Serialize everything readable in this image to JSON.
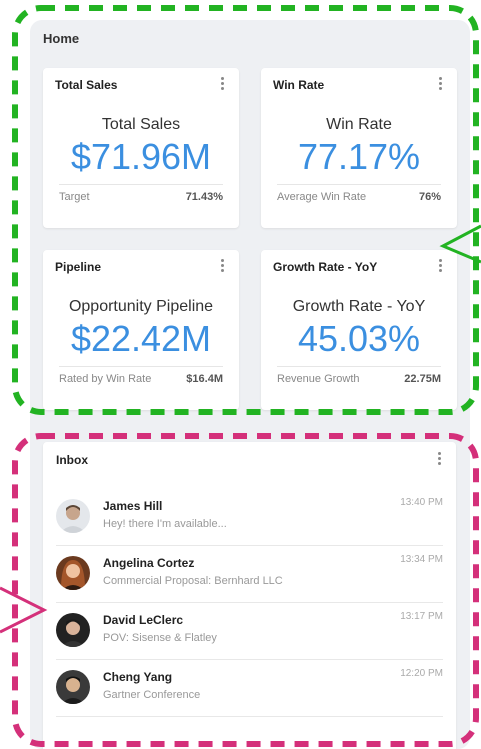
{
  "page": {
    "title": "Home"
  },
  "cards": [
    {
      "title": "Total Sales",
      "label": "Total Sales",
      "value": "$71.96M",
      "foot_label": "Target",
      "foot_value": "71.43%"
    },
    {
      "title": "Win Rate",
      "label": "Win Rate",
      "value": "77.17%",
      "foot_label": "Average Win Rate",
      "foot_value": "76%"
    },
    {
      "title": "Pipeline",
      "label": "Opportunity Pipeline",
      "value": "$22.42M",
      "foot_label": "Rated by Win Rate",
      "foot_value": "$16.4M"
    },
    {
      "title": "Growth Rate - YoY",
      "label": "Growth Rate - YoY",
      "value": "45.03%",
      "foot_label": "Revenue Growth",
      "foot_value": "22.75M"
    }
  ],
  "inbox": {
    "title": "Inbox",
    "messages": [
      {
        "sender": "James Hill",
        "preview": "Hey! there I'm available...",
        "time": "13:40 PM"
      },
      {
        "sender": "Angelina Cortez",
        "preview": "Commercial Proposal: Bernhard LLC",
        "time": "13:34 PM"
      },
      {
        "sender": "David LeClerc",
        "preview": "POV: Sisense & Flatley",
        "time": "13:17 PM"
      },
      {
        "sender": "Cheng Yang",
        "preview": "Gartner Conference",
        "time": "12:20 PM"
      }
    ]
  },
  "colors": {
    "accent": "#3b8fe0",
    "highlight_green": "#22b322",
    "highlight_magenta": "#d4307a"
  }
}
